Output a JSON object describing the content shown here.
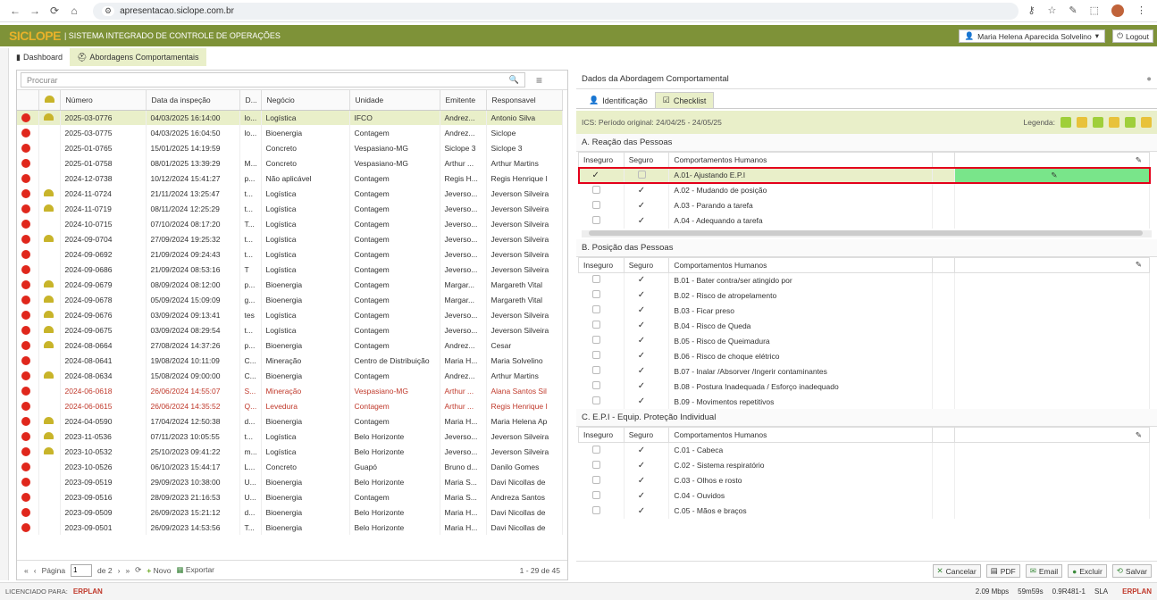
{
  "browser": {
    "url": "apresentacao.siclope.com.br"
  },
  "app": {
    "logo": "SICLOPE",
    "name": "| SISTEMA INTEGRADO DE CONTROLE DE OPERAÇÕES",
    "user": "Maria Helena Aparecida Solvelino",
    "logout": "Logout"
  },
  "tabs": [
    {
      "label": "Dashboard"
    },
    {
      "label": "Abordagens Comportamentais"
    }
  ],
  "left": {
    "search_placeholder": "Procurar",
    "columns": [
      "",
      "",
      "Número",
      "Data da inspeção",
      "D...",
      "Negócio",
      "Unidade",
      "Emitente",
      "Responsavel"
    ],
    "rows": [
      {
        "num": "2025-03-0776",
        "date": "04/03/2025 16:14:00",
        "d": "lo...",
        "neg": "Logística",
        "uni": "IFCO",
        "emit": "Andrez...",
        "resp": "Antonio Silva",
        "helmet": true,
        "sel": true
      },
      {
        "num": "2025-03-0775",
        "date": "04/03/2025 16:04:50",
        "d": "lo...",
        "neg": "Bioenergia",
        "uni": "Contagem",
        "emit": "Andrez...",
        "resp": "Siclope",
        "helmet": false
      },
      {
        "num": "2025-01-0765",
        "date": "15/01/2025 14:19:59",
        "d": "",
        "neg": "Concreto",
        "uni": "Vespasiano-MG",
        "emit": "Siclope 3",
        "resp": "Siclope 3",
        "helmet": false
      },
      {
        "num": "2025-01-0758",
        "date": "08/01/2025 13:39:29",
        "d": "M...",
        "neg": "Concreto",
        "uni": "Vespasiano-MG",
        "emit": "Arthur ...",
        "resp": "Arthur Martins",
        "helmet": false
      },
      {
        "num": "2024-12-0738",
        "date": "10/12/2024 15:41:27",
        "d": "p...",
        "neg": "Não aplicável",
        "uni": "Contagem",
        "emit": "Regis H...",
        "resp": "Regis Henrique I",
        "helmet": false
      },
      {
        "num": "2024-11-0724",
        "date": "21/11/2024 13:25:47",
        "d": "t...",
        "neg": "Logística",
        "uni": "Contagem",
        "emit": "Jeverso...",
        "resp": "Jeverson Silveira",
        "helmet": true
      },
      {
        "num": "2024-11-0719",
        "date": "08/11/2024 12:25:29",
        "d": "t...",
        "neg": "Logística",
        "uni": "Contagem",
        "emit": "Jeverso...",
        "resp": "Jeverson Silveira",
        "helmet": true
      },
      {
        "num": "2024-10-0715",
        "date": "07/10/2024 08:17:20",
        "d": "T...",
        "neg": "Logística",
        "uni": "Contagem",
        "emit": "Jeverso...",
        "resp": "Jeverson Silveira",
        "helmet": false
      },
      {
        "num": "2024-09-0704",
        "date": "27/09/2024 19:25:32",
        "d": "t...",
        "neg": "Logística",
        "uni": "Contagem",
        "emit": "Jeverso...",
        "resp": "Jeverson Silveira",
        "helmet": true
      },
      {
        "num": "2024-09-0692",
        "date": "21/09/2024 09:24:43",
        "d": "t...",
        "neg": "Logística",
        "uni": "Contagem",
        "emit": "Jeverso...",
        "resp": "Jeverson Silveira",
        "helmet": false
      },
      {
        "num": "2024-09-0686",
        "date": "21/09/2024 08:53:16",
        "d": "T",
        "neg": "Logística",
        "uni": "Contagem",
        "emit": "Jeverso...",
        "resp": "Jeverson Silveira",
        "helmet": false
      },
      {
        "num": "2024-09-0679",
        "date": "08/09/2024 08:12:00",
        "d": "p...",
        "neg": "Bioenergia",
        "uni": "Contagem",
        "emit": "Margar...",
        "resp": "Margareth Vital",
        "helmet": true
      },
      {
        "num": "2024-09-0678",
        "date": "05/09/2024 15:09:09",
        "d": "g...",
        "neg": "Bioenergia",
        "uni": "Contagem",
        "emit": "Margar...",
        "resp": "Margareth Vital",
        "helmet": true
      },
      {
        "num": "2024-09-0676",
        "date": "03/09/2024 09:13:41",
        "d": "tes",
        "neg": "Logística",
        "uni": "Contagem",
        "emit": "Jeverso...",
        "resp": "Jeverson Silveira",
        "helmet": true
      },
      {
        "num": "2024-09-0675",
        "date": "03/09/2024 08:29:54",
        "d": "t...",
        "neg": "Logística",
        "uni": "Contagem",
        "emit": "Jeverso...",
        "resp": "Jeverson Silveira",
        "helmet": true
      },
      {
        "num": "2024-08-0664",
        "date": "27/08/2024 14:37:26",
        "d": "p...",
        "neg": "Bioenergia",
        "uni": "Contagem",
        "emit": "Andrez...",
        "resp": "Cesar",
        "helmet": true
      },
      {
        "num": "2024-08-0641",
        "date": "19/08/2024 10:11:09",
        "d": "C...",
        "neg": "Mineração",
        "uni": "Centro de Distribuição",
        "emit": "Maria H...",
        "resp": "Maria Solvelino",
        "helmet": false
      },
      {
        "num": "2024-08-0634",
        "date": "15/08/2024 09:00:00",
        "d": "C...",
        "neg": "Bioenergia",
        "uni": "Contagem",
        "emit": "Andrez...",
        "resp": "Arthur Martins",
        "helmet": true
      },
      {
        "num": "2024-06-0618",
        "date": "26/06/2024 14:55:07",
        "d": "S...",
        "neg": "Mineração",
        "uni": "Vespasiano-MG",
        "emit": "Arthur ...",
        "resp": "Alana Santos Sil",
        "helmet": false,
        "red": true
      },
      {
        "num": "2024-06-0615",
        "date": "26/06/2024 14:35:52",
        "d": "Q...",
        "neg": "Levedura",
        "uni": "Contagem",
        "emit": "Arthur ...",
        "resp": "Regis Henrique I",
        "helmet": false,
        "red": true
      },
      {
        "num": "2024-04-0590",
        "date": "17/04/2024 12:50:38",
        "d": "d...",
        "neg": "Bioenergia",
        "uni": "Contagem",
        "emit": "Maria H...",
        "resp": "Maria Helena Ap",
        "helmet": true
      },
      {
        "num": "2023-11-0536",
        "date": "07/11/2023 10:05:55",
        "d": "t...",
        "neg": "Logística",
        "uni": "Belo Horizonte",
        "emit": "Jeverso...",
        "resp": "Jeverson Silveira",
        "helmet": true
      },
      {
        "num": "2023-10-0532",
        "date": "25/10/2023 09:41:22",
        "d": "m...",
        "neg": "Logística",
        "uni": "Belo Horizonte",
        "emit": "Jeverso...",
        "resp": "Jeverson Silveira",
        "helmet": true
      },
      {
        "num": "2023-10-0526",
        "date": "06/10/2023 15:44:17",
        "d": "L...",
        "neg": "Concreto",
        "uni": "Guapó",
        "emit": "Bruno d...",
        "resp": "Danilo Gomes",
        "helmet": false
      },
      {
        "num": "2023-09-0519",
        "date": "29/09/2023 10:38:00",
        "d": "U...",
        "neg": "Bioenergia",
        "uni": "Belo Horizonte",
        "emit": "Maria S...",
        "resp": "Davi Nicollas de",
        "helmet": false
      },
      {
        "num": "2023-09-0516",
        "date": "28/09/2023 21:16:53",
        "d": "U...",
        "neg": "Bioenergia",
        "uni": "Contagem",
        "emit": "Maria S...",
        "resp": "Andreza Santos",
        "helmet": false
      },
      {
        "num": "2023-09-0509",
        "date": "26/09/2023 15:21:12",
        "d": "d...",
        "neg": "Bioenergia",
        "uni": "Belo Horizonte",
        "emit": "Maria H...",
        "resp": "Davi Nicollas de",
        "helmet": false
      },
      {
        "num": "2023-09-0501",
        "date": "26/09/2023 14:53:56",
        "d": "T...",
        "neg": "Bioenergia",
        "uni": "Belo Horizonte",
        "emit": "Maria H...",
        "resp": "Davi Nicollas de",
        "helmet": false
      }
    ],
    "pager": {
      "page_label": "Página",
      "page": "1",
      "of": "de 2",
      "new": "Novo",
      "export": "Exportar",
      "count": "1 - 29 de 45"
    }
  },
  "right": {
    "title": "Dados da Abordagem Comportamental",
    "tabs": [
      {
        "label": "Identificação"
      },
      {
        "label": "Checklist"
      }
    ],
    "ics": "ICS:  Período original: 24/04/25 - 24/05/25",
    "legend": "Legenda:",
    "cols": {
      "inseguro": "Inseguro",
      "seguro": "Seguro",
      "comp": "Comportamentos Humanos"
    },
    "sections": [
      {
        "title": "A. Reação das Pessoas",
        "items": [
          {
            "label": "A.01- Ajustando E.P.I",
            "inseguro": true,
            "seguro": false,
            "hl": true
          },
          {
            "label": "A.02 - Mudando de posição",
            "inseguro": false,
            "seguro": true
          },
          {
            "label": "A.03 - Parando a tarefa",
            "inseguro": false,
            "seguro": true
          },
          {
            "label": "A.04 - Adequando a tarefa",
            "inseguro": false,
            "seguro": true
          }
        ]
      },
      {
        "title": "B. Posição das Pessoas",
        "items": [
          {
            "label": "B.01 - Bater contra/ser atingido por",
            "inseguro": false,
            "seguro": true
          },
          {
            "label": "B.02 - Risco de atropelamento",
            "inseguro": false,
            "seguro": true
          },
          {
            "label": "B.03 - Ficar preso",
            "inseguro": false,
            "seguro": true
          },
          {
            "label": "B.04 - Risco de Queda",
            "inseguro": false,
            "seguro": true
          },
          {
            "label": "B.05 - Risco de Queimadura",
            "inseguro": false,
            "seguro": true
          },
          {
            "label": "B.06 - Risco de choque elétrico",
            "inseguro": false,
            "seguro": true
          },
          {
            "label": "B.07 - Inalar /Absorver /Ingerir contaminantes",
            "inseguro": false,
            "seguro": true
          },
          {
            "label": "B.08 - Postura Inadequada / Esforço inadequado",
            "inseguro": false,
            "seguro": true
          },
          {
            "label": "B.09 - Movimentos repetitivos",
            "inseguro": false,
            "seguro": true
          }
        ]
      },
      {
        "title": "C. E.P.I - Equip. Proteção Individual",
        "items": [
          {
            "label": "C.01 - Cabeca",
            "inseguro": false,
            "seguro": true
          },
          {
            "label": "C.02 - Sistema respiratório",
            "inseguro": false,
            "seguro": true
          },
          {
            "label": "C.03 - Olhos e rosto",
            "inseguro": false,
            "seguro": true
          },
          {
            "label": "C.04 - Ouvidos",
            "inseguro": false,
            "seguro": true
          },
          {
            "label": "C.05 - Mãos e braços",
            "inseguro": false,
            "seguro": true
          }
        ]
      }
    ],
    "buttons": [
      "Cancelar",
      "PDF",
      "Email",
      "Excluir",
      "Salvar"
    ]
  },
  "status": {
    "licensed": "LICENCIADO PARA:",
    "brand": "ERPLAN",
    "speed": "2.09 Mbps",
    "time": "59m59s",
    "version": "0.9R481-1",
    "sla": "SLA",
    "brand2": "ERPLAN"
  },
  "colors": {
    "accent": "#7e9238",
    "selected": "#e9efc9",
    "alert": "#e0271c",
    "highlight": "#e4001b",
    "edit": "#79e58a"
  }
}
